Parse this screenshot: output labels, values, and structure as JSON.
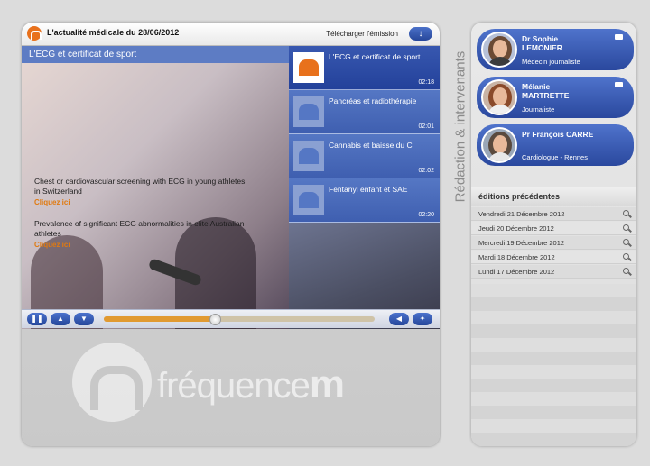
{
  "header": {
    "title": "L'actualité médicale du 28/06/2012",
    "download_label": "Télécharger l'émission",
    "download_icon": "arrow-down-icon"
  },
  "video": {
    "title": "L'ECG et certificat de sport",
    "overlays": [
      {
        "text": "Chest or cardiovascular screening with ECG in young athletes in Switzerland",
        "link": "Cliquez ici"
      },
      {
        "text": "Prevalence of significant ECG abnormalities in elite Australian athletes",
        "link": "Cliquez ici"
      }
    ]
  },
  "playlist": [
    {
      "title": "L'ECG et certificat de sport",
      "duration": "02:18"
    },
    {
      "title": "Pancréas et radiothérapie",
      "duration": "02:01"
    },
    {
      "title": "Cannabis et baisse du Cl",
      "duration": "02:02"
    },
    {
      "title": "Fentanyl enfant et SAE",
      "duration": "02:20"
    }
  ],
  "controls": {
    "play_icon": "pause-icon",
    "prev_icon": "chevron-up-icon",
    "next_icon": "chevron-down-icon",
    "volume_icon": "volume-icon",
    "fullscreen_icon": "fullscreen-icon",
    "progress_percent": 41
  },
  "brand": {
    "name_light": "fréquence",
    "name_bold": "m"
  },
  "side_label": "Rédaction & intervenants",
  "people": [
    {
      "first": "Dr Sophie",
      "last": "LEMONIER",
      "role": "Médecin journaliste"
    },
    {
      "first": "Mélanie",
      "last": "MARTRETTE",
      "role": "Journaliste"
    },
    {
      "first": "Pr François CARRE",
      "last": "",
      "role": "Cardiologue - Rennes"
    }
  ],
  "previous": {
    "heading": "éditions précédentes",
    "items": [
      "Vendredi 21 Décembre 2012",
      "Jeudi 20 Décembre 2012",
      "Mercredi 19 Décembre 2012",
      "Mardi 18 Décembre 2012",
      "Lundi 17 Décembre 2012"
    ]
  }
}
